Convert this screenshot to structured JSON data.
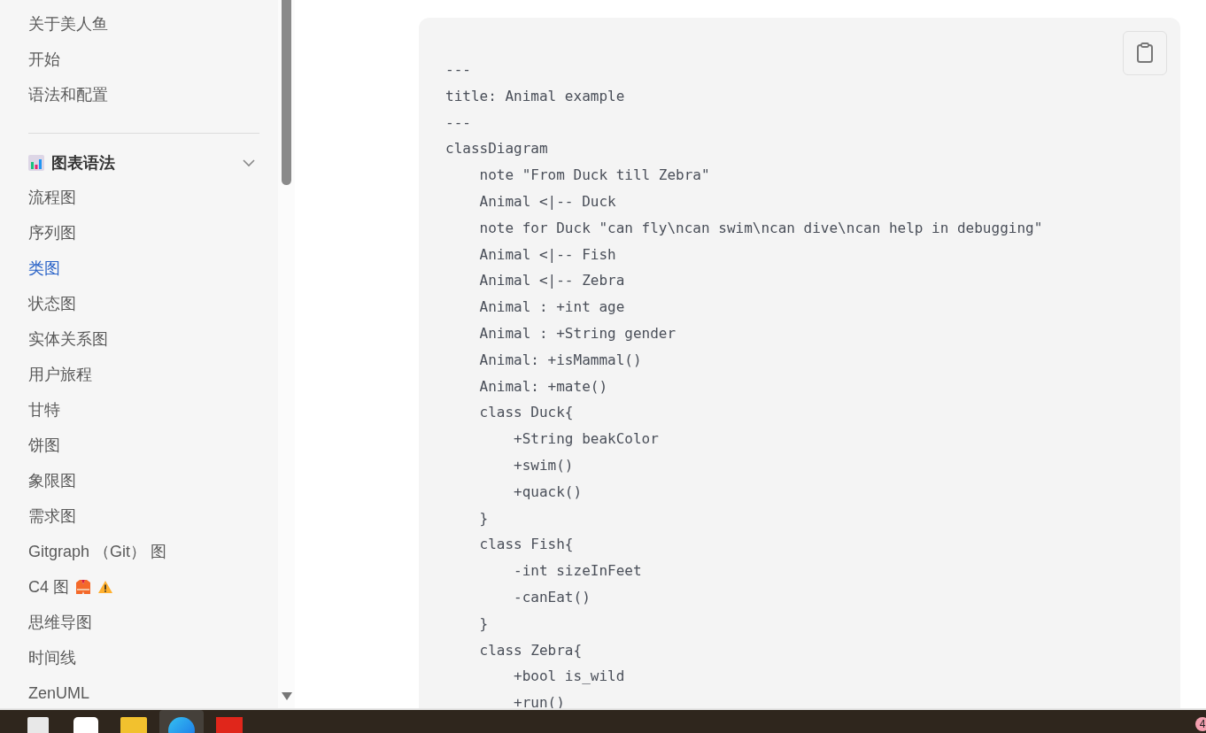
{
  "sidebar": {
    "top_items": [
      {
        "label": "关于美人鱼",
        "selected": false
      },
      {
        "label": "开始",
        "selected": false
      },
      {
        "label": "语法和配置",
        "selected": false
      }
    ],
    "section": {
      "title": "图表语法",
      "expanded": true
    },
    "items": [
      {
        "label": "流程图",
        "selected": false,
        "kind": "plain"
      },
      {
        "label": "序列图",
        "selected": false,
        "kind": "plain"
      },
      {
        "label": "类图",
        "selected": true,
        "kind": "plain"
      },
      {
        "label": "状态图",
        "selected": false,
        "kind": "plain"
      },
      {
        "label": "实体关系图",
        "selected": false,
        "kind": "plain"
      },
      {
        "label": "用户旅程",
        "selected": false,
        "kind": "plain"
      },
      {
        "label": "甘特",
        "selected": false,
        "kind": "plain"
      },
      {
        "label": "饼图",
        "selected": false,
        "kind": "plain"
      },
      {
        "label": "象限图",
        "selected": false,
        "kind": "plain"
      },
      {
        "label": "需求图",
        "selected": false,
        "kind": "plain"
      },
      {
        "label": "Gitgraph （Git） 图",
        "selected": false,
        "kind": "plain"
      },
      {
        "label": "C4 图",
        "selected": false,
        "kind": "experimental"
      },
      {
        "label": "思维导图",
        "selected": false,
        "kind": "plain"
      },
      {
        "label": "时间线",
        "selected": false,
        "kind": "plain"
      },
      {
        "label": "ZenUML",
        "selected": false,
        "kind": "plain"
      }
    ]
  },
  "code_block": {
    "lines": [
      "---",
      "title: Animal example",
      "---",
      "classDiagram",
      "    note \"From Duck till Zebra\"",
      "    Animal <|-- Duck",
      "    note for Duck \"can fly\\ncan swim\\ncan dive\\ncan help in debugging\"",
      "    Animal <|-- Fish",
      "    Animal <|-- Zebra",
      "    Animal : +int age",
      "    Animal : +String gender",
      "    Animal: +isMammal()",
      "    Animal: +mate()",
      "    class Duck{",
      "        +String beakColor",
      "        +swim()",
      "        +quack()",
      "    }",
      "    class Fish{",
      "        -int sizeInFeet",
      "        -canEat()",
      "    }",
      "    class Zebra{",
      "        +bool is_wild",
      "        +run()"
    ]
  },
  "taskbar": {
    "notification_count": "4"
  }
}
